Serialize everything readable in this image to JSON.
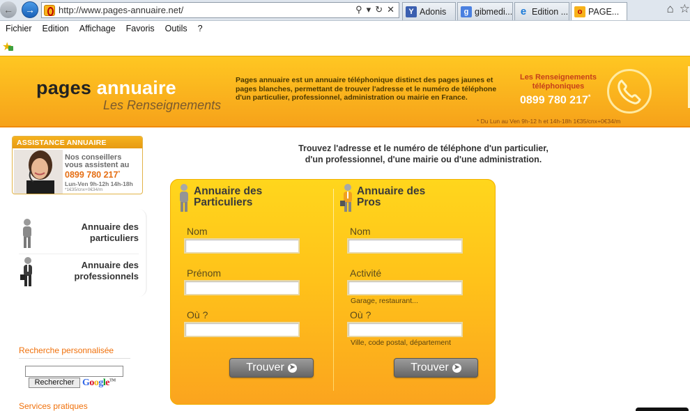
{
  "browser": {
    "url": "http://www.pages-annuaire.net/",
    "tabs": [
      {
        "label": "Adonis",
        "active": false
      },
      {
        "label": "gibmedi...",
        "active": false
      },
      {
        "label": "Edition ...",
        "active": false
      },
      {
        "label": "PAGE...",
        "active": true
      }
    ],
    "menu": [
      "Fichier",
      "Edition",
      "Affichage",
      "Favoris",
      "Outils",
      "?"
    ]
  },
  "header": {
    "logo_main": "pages ",
    "logo_accent": "annuaire",
    "logo_sub": "Les Renseignements",
    "description": "Pages annuaire est un annuaire téléphonique distinct des pages jaunes et pages blanches, permettant de trouver l'adresse et le numéro de téléphone d'un particulier, professionnel, administration ou mairie en France.",
    "phone_label": "Les Renseignements téléphoniques",
    "phone": "0899 780 217",
    "phone_star": "*",
    "phone_note": "* Du Lun au Ven 9h-12 h et 14h-18h 1€35/cnx+0€34/m"
  },
  "assistance": {
    "title": "ASSISTANCE ANNUAIRE",
    "text_1": "Nos conseillers",
    "text_2": "vous assistent au",
    "phone": "0899 780 217",
    "phone_star": "*",
    "hours": "Lun-Ven 9h-12h 14h-18h",
    "rate": "*1€35/cnx+0€34/m"
  },
  "side_menu": [
    {
      "line1": "Annuaire des",
      "line2": "particuliers"
    },
    {
      "line1": "Annuaire des",
      "line2": "professionnels"
    }
  ],
  "google": {
    "label": "Recherche personnalisée",
    "button": "Rechercher",
    "logo": [
      "G",
      "o",
      "o",
      "g",
      "l",
      "e"
    ],
    "tm": "TM",
    "input_value": ""
  },
  "services_label": "Services pratiques",
  "main": {
    "intro_1": "Trouvez l'adresse et le numéro de téléphone d'un particulier,",
    "intro_2": "d'un professionnel, d'une mairie ou d'une administration."
  },
  "particuliers": {
    "title_1": "Annuaire des",
    "title_2": "Particuliers",
    "fields": [
      {
        "label": "Nom",
        "value": ""
      },
      {
        "label": "Prénom",
        "value": ""
      },
      {
        "label": "Où ?",
        "value": ""
      }
    ],
    "button": "Trouver"
  },
  "pros": {
    "title_1": "Annuaire des",
    "title_2": "Pros",
    "fields": [
      {
        "label": "Nom",
        "value": "",
        "hint": ""
      },
      {
        "label": "Activité",
        "value": "",
        "hint": "Garage, restaurant..."
      },
      {
        "label": "Où ?",
        "value": "",
        "hint": "Ville, code postal, département"
      }
    ],
    "button": "Trouver"
  },
  "colors": {
    "header_top": "#ffc722",
    "header_bottom": "#f6a21a",
    "accent_orange": "#f0700a",
    "panel_yellow": "#ffc21a"
  },
  "icons": [
    "back-arrow-icon",
    "forward-arrow-icon",
    "search-icon",
    "refresh-icon",
    "home-icon",
    "star-icon",
    "phone-icon",
    "person-icon",
    "businessman-icon"
  ]
}
